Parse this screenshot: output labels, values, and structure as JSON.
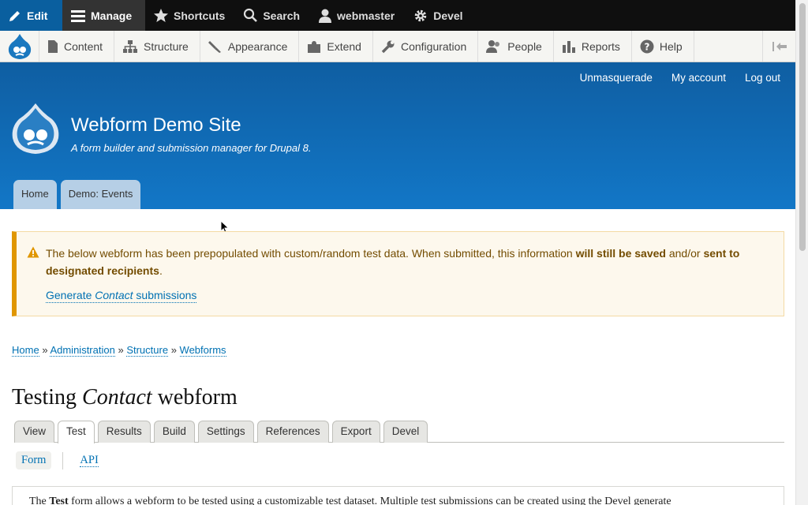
{
  "toolbar": {
    "edit": "Edit",
    "manage": "Manage",
    "shortcuts": "Shortcuts",
    "search": "Search",
    "user": "webmaster",
    "devel": "Devel"
  },
  "tray": {
    "items": [
      "Content",
      "Structure",
      "Appearance",
      "Extend",
      "Configuration",
      "People",
      "Reports",
      "Help"
    ]
  },
  "header": {
    "secondary_menu": [
      "Unmasquerade",
      "My account",
      "Log out"
    ],
    "site_name": "Webform Demo Site",
    "site_slogan": "A form builder and submission manager for Drupal 8.",
    "primary_tabs": [
      "Home",
      "Demo: Events"
    ]
  },
  "warning": {
    "text_1": "The below webform has been prepopulated with custom/random test data. When submitted, this information ",
    "bold_1": "will still be saved",
    "text_2": " and/or ",
    "bold_2": "sent to designated recipients",
    "text_3": ".",
    "link_pre": "Generate ",
    "link_em": "Contact",
    "link_post": " submissions"
  },
  "breadcrumb": [
    "Home",
    "Administration",
    "Structure",
    "Webforms"
  ],
  "breadcrumb_sep": "»",
  "page_title": {
    "pre": "Testing ",
    "em": "Contact",
    "post": " webform"
  },
  "local_tabs": [
    "View",
    "Test",
    "Results",
    "Build",
    "Settings",
    "References",
    "Export",
    "Devel"
  ],
  "active_local_tab": "Test",
  "sub_tabs": [
    "Form",
    "API"
  ],
  "description": {
    "pre": "The ",
    "bold": "Test",
    "post": " form allows a webform to be tested using a customizable test dataset. Multiple test submissions can be created using the Devel generate"
  },
  "colors": {
    "toolbar_bg": "#0f0f0f",
    "edit_bg": "#0a5f9f",
    "header_blue": "#1277c7",
    "link": "#0071b3",
    "warning_border": "#e09600"
  }
}
